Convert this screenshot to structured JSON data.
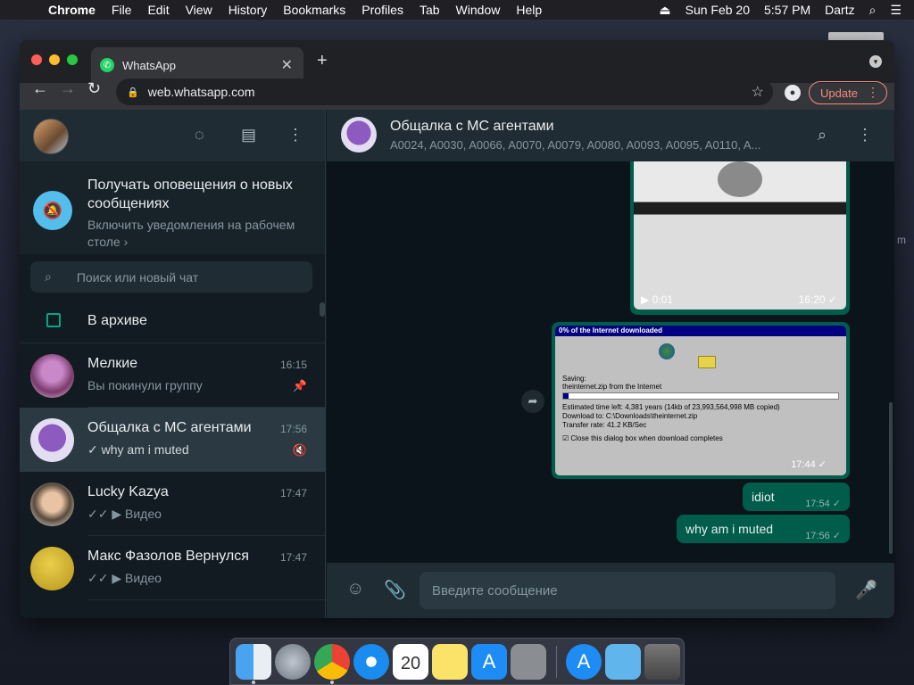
{
  "menubar": {
    "apple": "",
    "app": "Chrome",
    "items": [
      "File",
      "Edit",
      "View",
      "History",
      "Bookmarks",
      "Profiles",
      "Tab",
      "Window",
      "Help"
    ],
    "date": "Sun Feb 20",
    "time": "5:57 PM",
    "user": "Dartz"
  },
  "browser": {
    "tab_title": "WhatsApp",
    "url": "web.whatsapp.com",
    "update_label": "Update"
  },
  "sidebar": {
    "notification": {
      "title": "Получать оповещения о новых сообщениях",
      "subtitle": "Включить уведомления на рабочем столе ›"
    },
    "search_placeholder": "Поиск или новый чат",
    "archive_label": "В архиве",
    "chats": [
      {
        "name": "Мелкие",
        "time": "16:15",
        "preview": "Вы покинули группу",
        "icon": "pin-icon"
      },
      {
        "name": "Общалка с МС агентами",
        "time": "17:56",
        "preview": "✓ why am i muted",
        "icon": "muted-icon"
      },
      {
        "name": "Lucky Kazya",
        "time": "17:47",
        "preview": "✓✓ ▶ Видео",
        "icon": "video-icon"
      },
      {
        "name": "Макс Фазолов Вернулся",
        "time": "17:47",
        "preview": "✓✓ ▶ Видео",
        "icon": "video-icon"
      }
    ]
  },
  "conversation": {
    "title": "Общалка с МС агентами",
    "members": "A0024, A0030, A0066, A0070, A0079, A0080, A0093, A0095, A0110, A...",
    "video": {
      "duration": "0:01",
      "time": "16:20 ✓"
    },
    "image": {
      "window_title": "0% of the Internet downloaded",
      "saving_label": "Saving:",
      "file_line": "theinternet.zip from the Internet",
      "estimated": "Estimated time left:   4,381 years (14kb of 23,993,564,998 MB copied)",
      "download_to": "Download to:        C:\\Downloads\\theinternet.zip",
      "transfer": "Transfer rate:       41.2 KB/Sec",
      "checkbox": "Close this dialog box when download completes",
      "time": "17:44 ✓"
    },
    "messages": [
      {
        "text": "idiot",
        "time": "17:54 ✓"
      },
      {
        "text": "why am i muted",
        "time": "17:56 ✓"
      }
    ],
    "composer_placeholder": "Введите сообщение"
  },
  "desktop": {
    "side_text": "m"
  },
  "colors": {
    "accent": "#00a884",
    "bubble": "#005c4b",
    "panel": "#202c33",
    "bg": "#0b141a"
  }
}
